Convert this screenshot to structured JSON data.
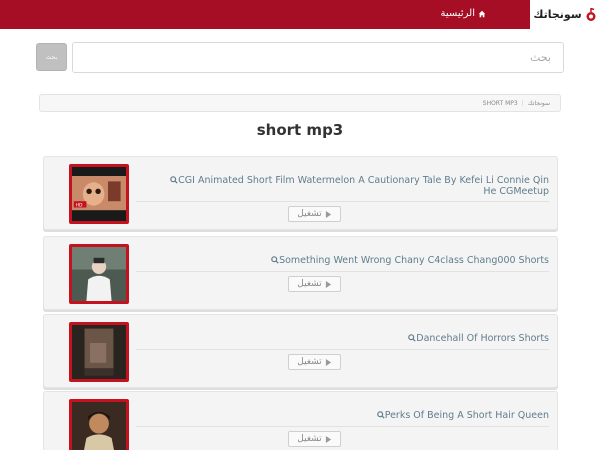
{
  "header": {
    "brand": "سونجاتك",
    "home_label": "الرئيسية",
    "bar_color": "#a50e24"
  },
  "search": {
    "placeholder": "بحث",
    "button_label": "بحث"
  },
  "breadcrumb": {
    "home": "سونجاتك",
    "current": "SHORT MP3"
  },
  "page": {
    "title": "short mp3"
  },
  "results": [
    {
      "title": "CGI Animated Short Film Watermelon A Cautionary Tale By Kefei Li Connie Qin He CGMeetup",
      "play_label": "تشغيل",
      "thumb_icon": "animated-film-thumbnail"
    },
    {
      "title": "Something Went Wrong Chany C4class Chang000 Shorts",
      "play_label": "تشغيل",
      "thumb_icon": "person-thumbnail"
    },
    {
      "title": "Dancehall Of Horrors Shorts",
      "play_label": "تشغيل",
      "thumb_icon": "dark-scene-thumbnail"
    },
    {
      "title": "Perks Of Being A Short Hair Queen",
      "play_label": "تشغيل",
      "thumb_icon": "portrait-thumbnail"
    }
  ]
}
